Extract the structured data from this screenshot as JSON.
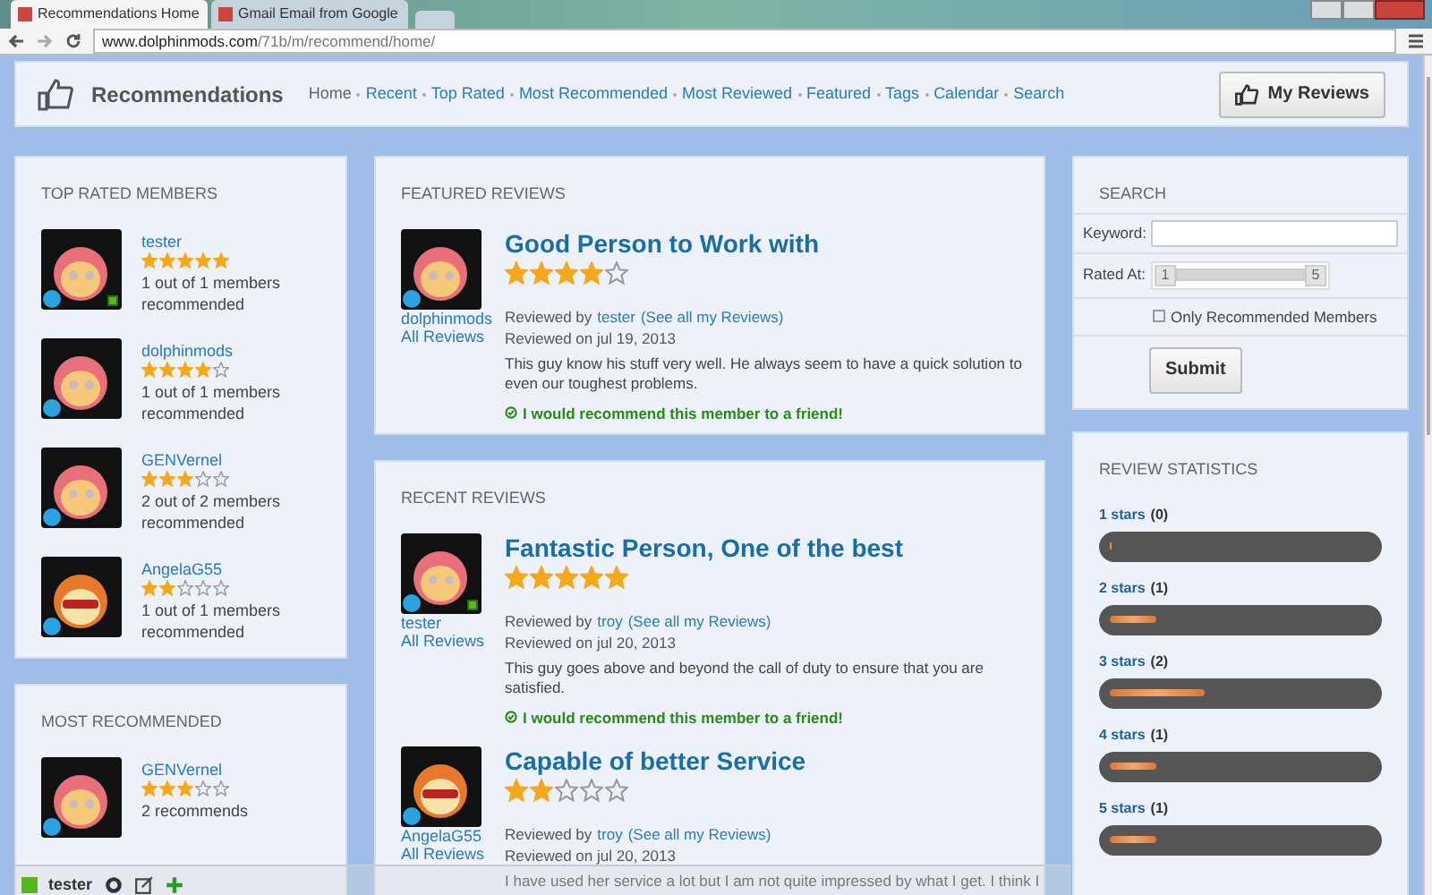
{
  "browser": {
    "tabs": [
      {
        "title": "Recommendations Home",
        "selected": true
      },
      {
        "title": "Gmail Email from Google",
        "selected": false
      }
    ],
    "url": {
      "domain": "www.dolphinmods.com",
      "path": "/71b/m/recommend/home/"
    }
  },
  "header": {
    "title": "Recommendations",
    "nav": [
      {
        "label": "Home",
        "selected": true
      },
      {
        "label": "Recent",
        "selected": false
      },
      {
        "label": "Top Rated",
        "selected": false
      },
      {
        "label": "Most Recommended",
        "selected": false
      },
      {
        "label": "Most Reviewed",
        "selected": false
      },
      {
        "label": "Featured",
        "selected": false
      },
      {
        "label": "Tags",
        "selected": false
      },
      {
        "label": "Calendar",
        "selected": false
      },
      {
        "label": "Search",
        "selected": false
      }
    ],
    "button": "My Reviews"
  },
  "top_rated": {
    "title": "TOP RATED MEMBERS",
    "members": [
      {
        "name": "tester",
        "stars": 5,
        "text": "1 out of 1 members recommended",
        "online": true,
        "kind": "pink"
      },
      {
        "name": "dolphinmods",
        "stars": 4,
        "text": "1 out of 1 members recommended",
        "online": false,
        "kind": "pink"
      },
      {
        "name": "GENVernel",
        "stars": 3,
        "text": "2 out of 2 members recommended",
        "online": false,
        "kind": "pink"
      },
      {
        "name": "AngelaG55",
        "stars": 2,
        "text": "1 out of 1 members recommended",
        "online": false,
        "kind": "orange"
      }
    ]
  },
  "most_recommended": {
    "title": "MOST RECOMMENDED",
    "members": [
      {
        "name": "GENVernel",
        "stars": 3,
        "text": "2 recommends",
        "online": false,
        "kind": "pink"
      }
    ]
  },
  "featured": {
    "title": "FEATURED REVIEWS",
    "reviews": [
      {
        "title": "Good Person to Work with",
        "stars": 4,
        "member": "dolphinmods",
        "all_reviews": "All Reviews",
        "online": false,
        "kind": "pink",
        "reviewed_by": "Reviewed by",
        "reviewer": "tester",
        "see_all": "(See all my Reviews)",
        "reviewed_on": "Reviewed on jul 19, 2013",
        "body": "This guy know his stuff very well. He always seem to have a quick solution to even our toughest problems.",
        "recommend": "I would recommend this member to a friend!"
      }
    ]
  },
  "recent": {
    "title": "RECENT REVIEWS",
    "reviews": [
      {
        "title": "Fantastic Person, One of the best",
        "stars": 5,
        "member": "tester",
        "all_reviews": "All Reviews",
        "online": true,
        "kind": "pink",
        "reviewed_by": "Reviewed by",
        "reviewer": "troy",
        "see_all": "(See all my Reviews)",
        "reviewed_on": "Reviewed on jul 20, 2013",
        "body": "This guy goes above and beyond the call of duty to ensure that you are satisfied.",
        "recommend": "I would recommend this member to a friend!"
      },
      {
        "title": "Capable of better Service",
        "stars": 2,
        "member": "AngelaG55",
        "all_reviews": "All Reviews",
        "online": false,
        "kind": "orange",
        "reviewed_by": "Reviewed by",
        "reviewer": "troy",
        "see_all": "(See all my Reviews)",
        "reviewed_on": "Reviewed on jul 20, 2013",
        "body": "I have used her service a lot but I am not quite impressed by what I get. I think I"
      }
    ]
  },
  "search": {
    "title": "SEARCH",
    "keyword_label": "Keyword:",
    "rated_label": "Rated At:",
    "range": {
      "min": "1",
      "max": "5",
      "level": 1
    },
    "checkbox": {
      "label": "Only Recommended Members",
      "checked": false
    },
    "submit": "Submit"
  },
  "stats": {
    "title": "REVIEW STATISTICS",
    "rows": [
      {
        "label": "1 stars",
        "count": "(0)",
        "level": 0
      },
      {
        "label": "2 stars",
        "count": "(1)",
        "level": 0.18
      },
      {
        "label": "3 stars",
        "count": "(2)",
        "level": 0.36
      },
      {
        "label": "4 stars",
        "count": "(1)",
        "level": 0.18
      },
      {
        "label": "5 stars",
        "count": "(1)",
        "level": 0.18
      }
    ]
  },
  "toolbar": {
    "user": "tester"
  }
}
